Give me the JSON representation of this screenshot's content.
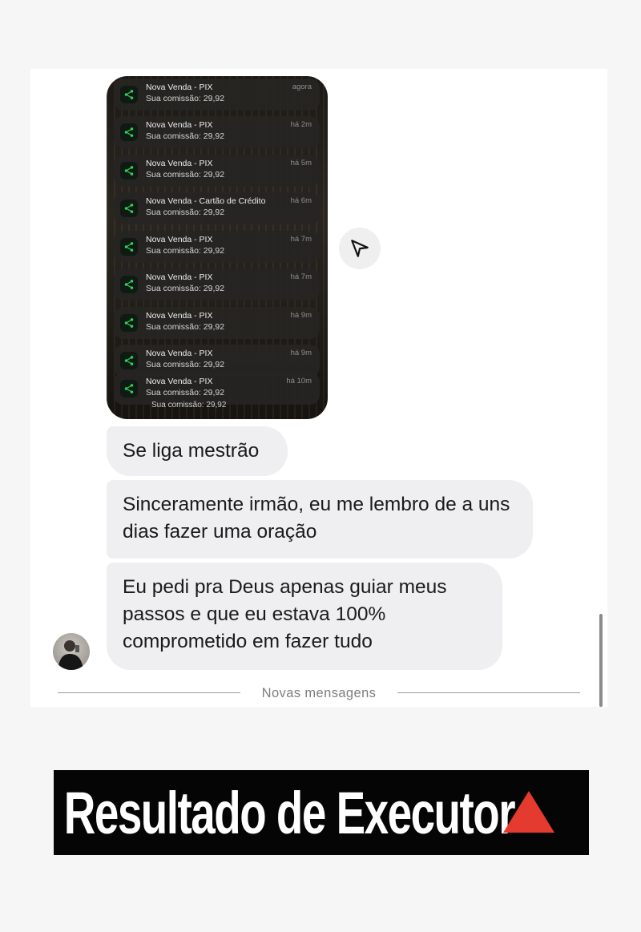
{
  "notifications": [
    {
      "title": "Nova Venda - PIX",
      "subtitle": "Sua comissão: 29,92",
      "time": "agora"
    },
    {
      "title": "Nova Venda - PIX",
      "subtitle": "Sua comissão: 29,92",
      "time": "há 2m"
    },
    {
      "title": "Nova Venda - PIX",
      "subtitle": "Sua comissão: 29,92",
      "time": "há 5m"
    },
    {
      "title": "Nova Venda - Cartão de Crédito",
      "subtitle": "Sua comissão: 29,92",
      "time": "há 6m"
    },
    {
      "title": "Nova Venda - PIX",
      "subtitle": "Sua comissão: 29,92",
      "time": "há 7m"
    },
    {
      "title": "Nova Venda - PIX",
      "subtitle": "Sua comissão: 29,92",
      "time": "há 7m"
    },
    {
      "title": "Nova Venda - PIX",
      "subtitle": "Sua comissão: 29,92",
      "time": "há 9m"
    },
    {
      "title": "Nova Venda - PIX",
      "subtitle": "Sua comissão: 29,92",
      "time": "há 9m"
    },
    {
      "title": "Nova Venda - PIX",
      "subtitle": "Sua comissão: 29,92",
      "time": "há 10m"
    }
  ],
  "notification_last_line": "Sua comissão: 29,92",
  "messages": [
    {
      "text": "Se liga mestrão"
    },
    {
      "text": "Sinceramente irmão, eu me lembro de a uns dias fazer uma oração"
    },
    {
      "text": "Eu pedi pra Deus apenas guiar meus passos e que eu estava 100% comprometido em fazer tudo"
    }
  ],
  "divider_label": "Novas mensagens",
  "banner": {
    "text": "Resultado de Executor",
    "emoji_color": "#e53b2f"
  },
  "colors": {
    "app_icon": "#2fd35a",
    "bubble": "#efeff1"
  },
  "icons": {
    "share": "send-icon",
    "app": "share-nodes-icon"
  }
}
